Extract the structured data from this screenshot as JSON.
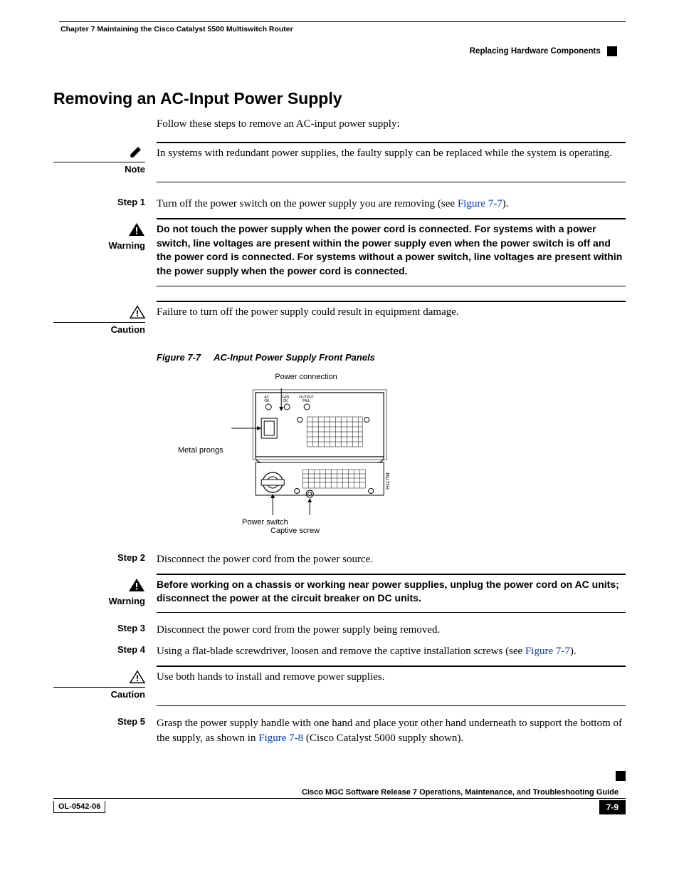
{
  "header": {
    "chapter": "Chapter 7      Maintaining the Cisco Catalyst 5500 Multiswitch Router",
    "section": "Replacing Hardware Components"
  },
  "title": "Removing an AC-Input Power Supply",
  "intro": "Follow these steps to remove an AC-input power supply:",
  "note": {
    "label": "Note",
    "text": "In systems with redundant power supplies, the faulty supply can be replaced while the system is operating."
  },
  "step1": {
    "label": "Step 1",
    "text_a": "Turn off the power switch on the power supply you are removing (see ",
    "link": "Figure 7-7",
    "text_b": ")."
  },
  "warning1": {
    "label": "Warning",
    "text": "Do not touch the power supply when the power cord is connected. For systems with a power switch, line voltages are present within the power supply even when the power switch is off and the power cord is connected. For systems without a power switch, line voltages are present within the power supply when the power cord is connected."
  },
  "caution1": {
    "label": "Caution",
    "text": "Failure to turn off the power supply could result in equipment damage."
  },
  "figure": {
    "num": "Figure 7-7",
    "title": "AC-Input Power Supply Front Panels",
    "callouts": {
      "power_connection": "Power connection",
      "metal_prongs": "Metal prongs",
      "power_switch": "Power switch",
      "captive_screw": "Captive screw"
    },
    "panel_labels": {
      "ac_ok": "AC OK",
      "fan_ok": "FAN OK",
      "output_fail": "OUTPUT FAIL"
    },
    "id": "H11764"
  },
  "step2": {
    "label": "Step 2",
    "text": "Disconnect the power cord from the power source."
  },
  "warning2": {
    "label": "Warning",
    "text": "Before working on a chassis or working near power supplies, unplug the power cord on AC units; disconnect the power at the circuit breaker on DC units."
  },
  "step3": {
    "label": "Step 3",
    "text": "Disconnect the power cord from the power supply being removed."
  },
  "step4": {
    "label": "Step 4",
    "text_a": "Using a flat-blade screwdriver, loosen and remove the captive installation screws (see ",
    "link": "Figure 7-7",
    "text_b": ")."
  },
  "caution2": {
    "label": "Caution",
    "text": "Use both hands to install and remove power supplies."
  },
  "step5": {
    "label": "Step 5",
    "text_a": "Grasp the power supply handle with one hand and place your other hand underneath to support the bottom of the supply, as shown in ",
    "link": "Figure 7-8",
    "text_b": " (Cisco Catalyst 5000 supply shown)."
  },
  "footer": {
    "title": "Cisco MGC Software Release 7 Operations, Maintenance, and Troubleshooting Guide",
    "docnum": "OL-0542-06",
    "page": "7-9"
  }
}
